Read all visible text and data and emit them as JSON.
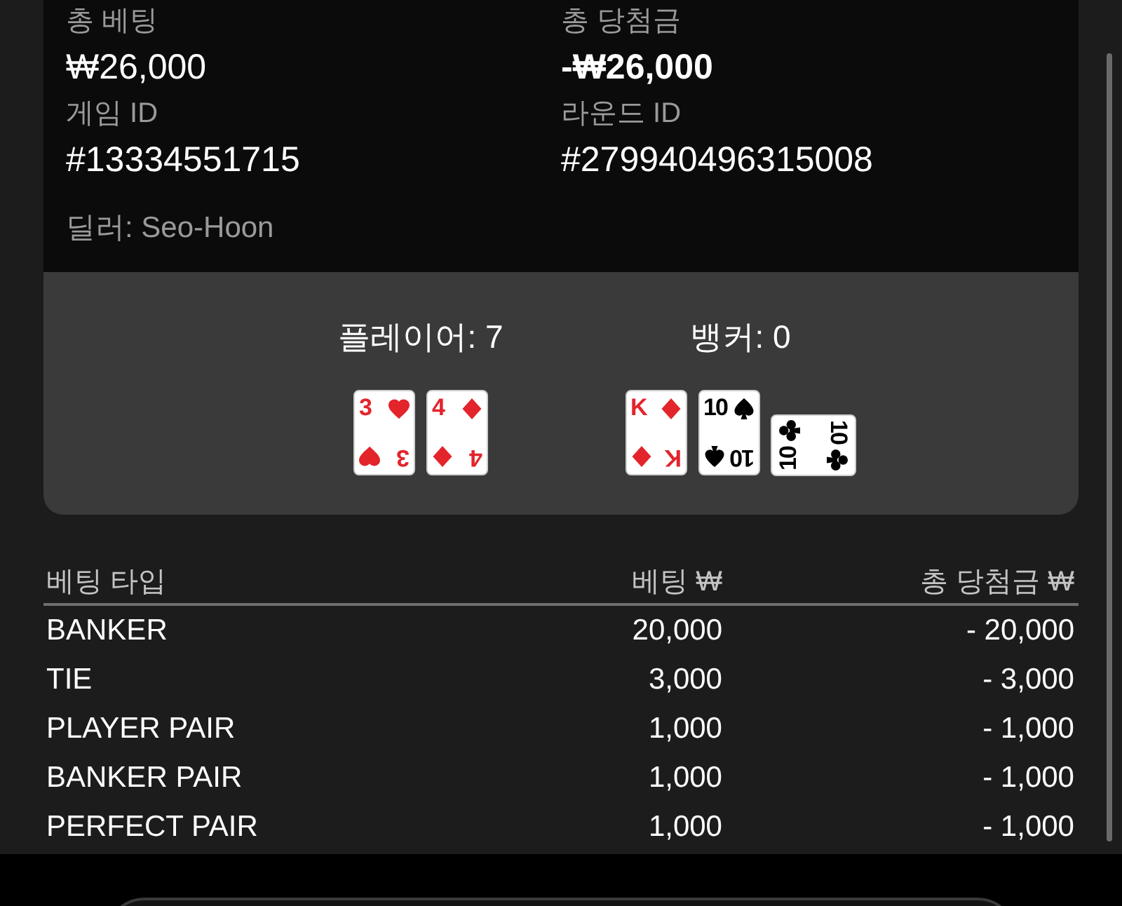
{
  "summary": {
    "fields": [
      {
        "label": "총 베팅",
        "value": "₩26,000",
        "bold": false
      },
      {
        "label": "총 당첨금",
        "value": "-₩26,000",
        "bold": true
      },
      {
        "label": "게임 ID",
        "value": "#13334551715",
        "bold": false
      },
      {
        "label": "라운드 ID",
        "value": "#279940496315008",
        "bold": false
      }
    ],
    "dealer": "딜러: Seo-Hoon"
  },
  "hands": [
    {
      "title": "플레이어: 7",
      "cards": [
        {
          "rank": "3",
          "rank_mirrored": "3",
          "kind": "hearts",
          "sideways": false
        },
        {
          "rank": "4",
          "rank_mirrored": "4",
          "kind": "diamonds",
          "sideways": false
        }
      ]
    },
    {
      "title": "뱅커: 0",
      "cards": [
        {
          "rank": "K",
          "rank_mirrored": "K",
          "kind": "diamonds",
          "sideways": false
        },
        {
          "rank": "10",
          "rank_mirrored": "10",
          "kind": "spades",
          "sideways": false
        },
        {
          "rank": "10",
          "rank_mirrored": "10",
          "kind": "clubs",
          "sideways": true
        }
      ]
    }
  ],
  "bets_table": {
    "columns": [
      "베팅 타입",
      "베팅 ₩",
      "총 당첨금 ₩"
    ],
    "rows": [
      [
        "BANKER",
        "20,000",
        "- 20,000"
      ],
      [
        "TIE",
        "3,000",
        "- 3,000"
      ],
      [
        "PLAYER PAIR",
        "1,000",
        "- 1,000"
      ],
      [
        "BANKER PAIR",
        "1,000",
        "- 1,000"
      ],
      [
        "PERFECT PAIR",
        "1,000",
        "- 1,000"
      ]
    ]
  }
}
